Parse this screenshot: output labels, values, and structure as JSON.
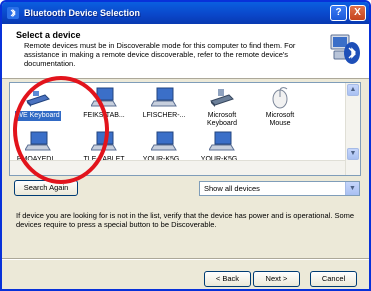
{
  "window": {
    "title": "Bluetooth Device Selection",
    "help_label": "?",
    "close_label": "X"
  },
  "header": {
    "title": "Select a device",
    "description": "Remote devices must be in Discoverable mode for this computer to find them. For assistance in making a remote device discoverable, refer to the remote device's documentation."
  },
  "devices": [
    {
      "label": "WE Keyboard",
      "icon": "keyboard-icon",
      "selected": true
    },
    {
      "label": "FEIKS-TAB...",
      "icon": "laptop-icon",
      "selected": false
    },
    {
      "label": "LFISCHER-...",
      "icon": "laptop-icon",
      "selected": false
    },
    {
      "label": "Microsoft Keyboard",
      "icon": "keyboard-icon",
      "selected": false
    },
    {
      "label": "Microsoft Mouse",
      "icon": "mouse-icon",
      "selected": false
    },
    {
      "label": "PMOAYEDI...",
      "icon": "laptop-icon",
      "selected": false
    },
    {
      "label": "TLE-TABLET",
      "icon": "laptop-icon",
      "selected": false
    },
    {
      "label": "YOUR-K5G...",
      "icon": "laptop-icon",
      "selected": false
    },
    {
      "label": "YOUR-K5G...",
      "icon": "laptop-icon",
      "selected": false
    }
  ],
  "search_button": "Search Again",
  "filter": {
    "selected": "Show all devices"
  },
  "info_text": "If device you are looking for is not in the list, verify that the device has power and is operational. Some devices require to press a special button to be Discoverable.",
  "buttons": {
    "back": "< Back",
    "next": "Next >",
    "cancel": "Cancel"
  },
  "colors": {
    "title_bar": "#0a46c9",
    "selection": "#316ac5",
    "annotation_circle": "#e2141c"
  }
}
